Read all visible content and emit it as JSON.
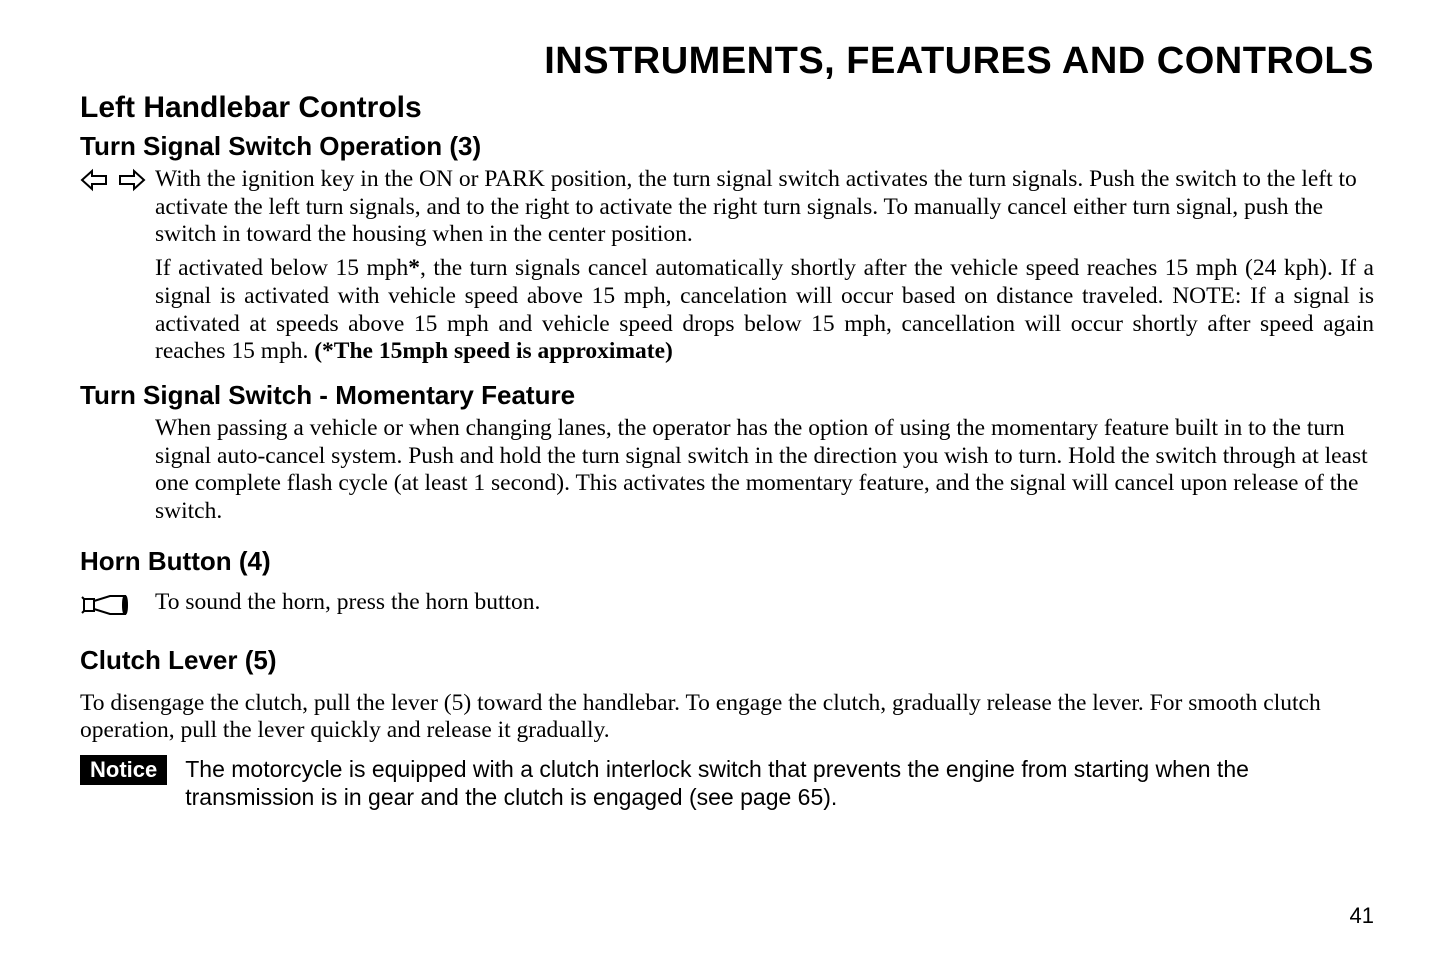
{
  "mainTitle": "INSTRUMENTS, FEATURES AND CONTROLS",
  "sectionHeading": "Left Handlebar Controls",
  "subsections": {
    "turnSignalOp": {
      "heading": "Turn Signal Switch Operation (3)",
      "paragraph1": "With the ignition key in the ON or PARK position, the turn signal switch activates the turn signals. Push the switch to the left to activate the left turn signals, and to the right to activate the right turn signals. To manually cancel either turn signal, push the switch in toward the housing when in the center position.",
      "paragraph2_part1": "If activated below 15 mph",
      "paragraph2_bold1": "*",
      "paragraph2_part2": ", the turn signals cancel automatically shortly after the vehicle speed reaches 15 mph (24 kph). If a signal is activated with vehicle speed above 15 mph, cancelation will occur based on distance traveled. NOTE: If a signal is activated at speeds above 15 mph and vehicle speed drops below 15 mph, cancellation will occur shortly after speed again reaches 15 mph. ",
      "paragraph2_bold2": "(*The 15mph speed is approximate)"
    },
    "momentary": {
      "heading": "Turn Signal Switch - Momentary Feature",
      "paragraph": "When passing a vehicle or when changing lanes, the operator has the option of using the momentary feature built in to the turn signal auto-cancel system. Push and hold the turn signal switch in the direction you wish to turn. Hold the switch through at least one complete flash cycle (at least 1 second). This activates the momentary feature, and the signal will cancel upon release of the switch."
    },
    "horn": {
      "heading": "Horn Button (4)",
      "paragraph": "To sound the horn, press the horn button."
    },
    "clutch": {
      "heading": "Clutch Lever (5)",
      "paragraph": "To disengage the clutch, pull the lever (5) toward the handlebar. To engage the clutch, gradually release the lever. For smooth clutch operation, pull the lever quickly and release it gradually."
    }
  },
  "notice": {
    "label": "Notice",
    "text": "The motorcycle is equipped with a clutch interlock switch that prevents the engine from starting when the transmission is in gear and the clutch is engaged (see page 65)."
  },
  "pageNumber": "41"
}
